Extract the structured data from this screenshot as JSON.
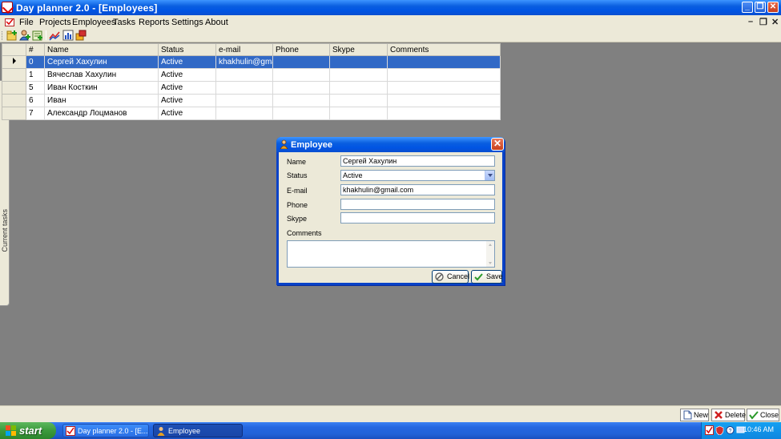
{
  "window": {
    "title": "Day planner 2.0 - [Employees]",
    "minimize": "_",
    "restore": "❐",
    "close": "✕"
  },
  "menu": {
    "items": [
      "File",
      "Projects",
      "Employees",
      "Tasks",
      "Reports",
      "Settings",
      "About"
    ],
    "mdi_controls": [
      "–",
      "❐",
      "✕"
    ]
  },
  "toolbar": {
    "buttons": [
      "new-project-icon",
      "add-employee-icon",
      "add-task-icon",
      "chart-icon",
      "report-icon",
      "settings-icon"
    ]
  },
  "side_tab": {
    "label": "Current tasks"
  },
  "grid": {
    "columns": [
      "#",
      "Name",
      "Status",
      "e-mail",
      "Phone",
      "Skype",
      "Comments"
    ],
    "rows": [
      {
        "id": "0",
        "name": "Сергей Хахулин",
        "status": "Active",
        "email": "khakhulin@gmail...",
        "phone": "",
        "skype": "",
        "comments": ""
      },
      {
        "id": "1",
        "name": "Вячеслав Хахулин",
        "status": "Active",
        "email": "",
        "phone": "",
        "skype": "",
        "comments": ""
      },
      {
        "id": "5",
        "name": "Иван Косткин",
        "status": "Active",
        "email": "",
        "phone": "",
        "skype": "",
        "comments": ""
      },
      {
        "id": "6",
        "name": "Иван",
        "status": "Active",
        "email": "",
        "phone": "",
        "skype": "",
        "comments": ""
      },
      {
        "id": "7",
        "name": "Александр Лоцманов",
        "status": "Active",
        "email": "",
        "phone": "",
        "skype": "",
        "comments": ""
      }
    ],
    "selected_row": 0
  },
  "dialog": {
    "title": "Employee",
    "close": "✕",
    "labels": {
      "name": "Name",
      "status": "Status",
      "email": "E-mail",
      "phone": "Phone",
      "skype": "Skype",
      "comments": "Comments"
    },
    "values": {
      "name": "Сергей Хахулин",
      "status": "Active",
      "email": "khakhulin@gmail.com",
      "phone": "",
      "skype": "",
      "comments": ""
    },
    "cancel_label": "Cancel",
    "save_label": "Save"
  },
  "bottom_buttons": {
    "new_label": "New",
    "delete_label": "Delete",
    "close_label": "Close"
  },
  "taskbar": {
    "start_label": "start",
    "tasks": [
      "Day planner 2.0 - [E...",
      "Employee"
    ],
    "clock": "10:46 AM"
  },
  "colors": {
    "titlebar": "#0054e3",
    "selection": "#3169c6",
    "workspace": "#808080",
    "chrome": "#ece9d8"
  }
}
